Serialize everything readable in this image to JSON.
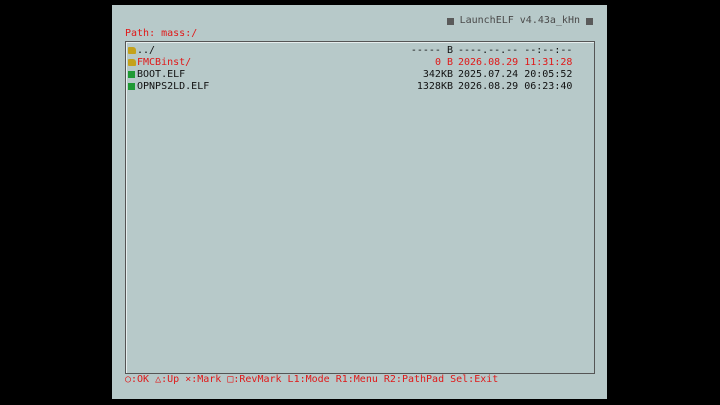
{
  "title": "LaunchELF v4.43a_kHn",
  "path_label": "Path: mass:/",
  "files": [
    {
      "name": "../",
      "size": "----- B",
      "date": "----.--.-- --:--:--",
      "kind": "folder",
      "selected": false
    },
    {
      "name": "FMCBinst/",
      "size": "0 B",
      "date": "2026.08.29 11:31:28",
      "kind": "folder",
      "selected": true
    },
    {
      "name": "BOOT.ELF",
      "size": "342KB",
      "date": "2025.07.24 20:05:52",
      "kind": "file",
      "selected": false
    },
    {
      "name": "OPNPS2LD.ELF",
      "size": "1328KB",
      "date": "2026.08.29 06:23:40",
      "kind": "file",
      "selected": false
    }
  ],
  "footer": "○:OK △:Up ×:Mark □:RevMark L1:Mode R1:Menu R2:PathPad Sel:Exit",
  "colors": {
    "background": "#b7c9c9",
    "accent": "#e01818",
    "folder": "#c4a21c",
    "file": "#1f9a34"
  }
}
